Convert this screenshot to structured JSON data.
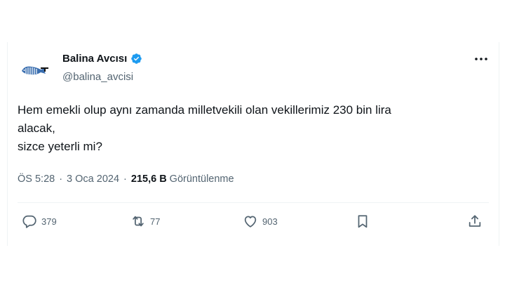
{
  "author": {
    "display_name": "Balina Avcısı",
    "handle": "@balina_avcisi",
    "verified": true,
    "avatar_icon": "whale-logo-icon"
  },
  "tweet": {
    "lines": [
      "Hem emekli olup aynı zamanda milletvekili olan vekillerimiz 230 bin lira",
      "alacak,",
      "sizce yeterli mi?"
    ]
  },
  "meta": {
    "time": "ÖS 5:28",
    "separator": "·",
    "date": "3 Oca 2024",
    "views_count": "215,6 B",
    "views_label": "Görüntülenme"
  },
  "actions": {
    "replies": "379",
    "reposts": "77",
    "likes": "903"
  },
  "colors": {
    "text": "#0f1419",
    "secondary": "#536471",
    "verified": "#1d9bf0",
    "divider": "#eff3f4"
  }
}
